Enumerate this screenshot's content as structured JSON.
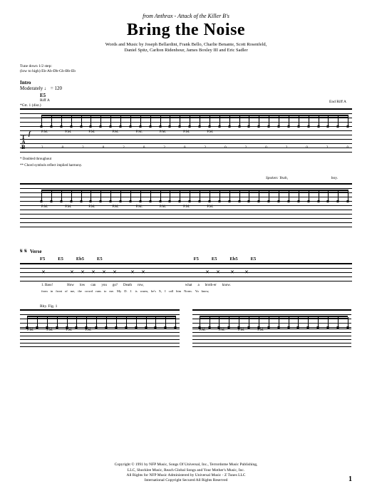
{
  "header": {
    "source_prefix": "from Anthrax - ",
    "source_album": "Attack of the Killer B's",
    "title": "Bring the Noise",
    "credits_line1": "Words and Music by Joseph Bellardini, Frank Bello, Charlie Benante, Scott Rosenfeld,",
    "credits_line2": "Daniel Spitz, Carlton Ridenhour, James Boxley III and Eric Sadler"
  },
  "tuning": {
    "line1": "Tune down 1/2 step:",
    "line2": "(low to high) Eb-Ab-Db-Gb-Bb-Eb"
  },
  "intro": {
    "label": "Intro",
    "tempo": "Moderately ♩ = 120",
    "chord": "E5",
    "gtr": "*Gtr. 1 (dist.)",
    "riff_a": "Riff A",
    "end_riff": "End Riff A",
    "dynamic": "f",
    "pm": "P.M.",
    "tab_fret": "2",
    "tab_string_fret": "0",
    "footnote1": "* Doubled throughout",
    "footnote2": "** Chord symbols reflect implied harmony."
  },
  "system2": {
    "spoken": "Spoken: Yeah,",
    "boy": "boy."
  },
  "verse": {
    "segno": "𝄋 𝄋",
    "label": "Verse",
    "chords": [
      "F5",
      "E5",
      "Eb5",
      "E5",
      "F5",
      "E5",
      "Eb5",
      "E5"
    ],
    "lyric_num": "1. Bass!",
    "lyrics1": [
      "How",
      "low",
      "can",
      "you",
      "go?",
      "Death",
      "row,",
      "",
      "what",
      "a",
      "broth-er",
      "know."
    ],
    "lyrics2": [
      "from",
      "in",
      "front",
      "of",
      "me,",
      "the",
      "crowd",
      "runs",
      "to",
      "me.",
      "My",
      "D.",
      "J.",
      "is",
      "warm,",
      "he's",
      "X,",
      "I",
      "call",
      "him",
      "Norm.",
      "Ya",
      "know,"
    ],
    "rhy_fig": "Rhy. Fig. 1",
    "pm": "P.M."
  },
  "copyright": {
    "line1": "Copyright © 1991 by NFP Music, Songs Of Universal, Inc., Terrordome Music Publishing,",
    "line2": "LLC, Shocklee Music, Reach Global Songs and Your Mother's Music, Inc.",
    "line3": "All Rights for NFP Music Administered by Universal Music - Z Tunes LLC",
    "line4": "International Copyright Secured   All Rights Reserved"
  },
  "page": "1"
}
